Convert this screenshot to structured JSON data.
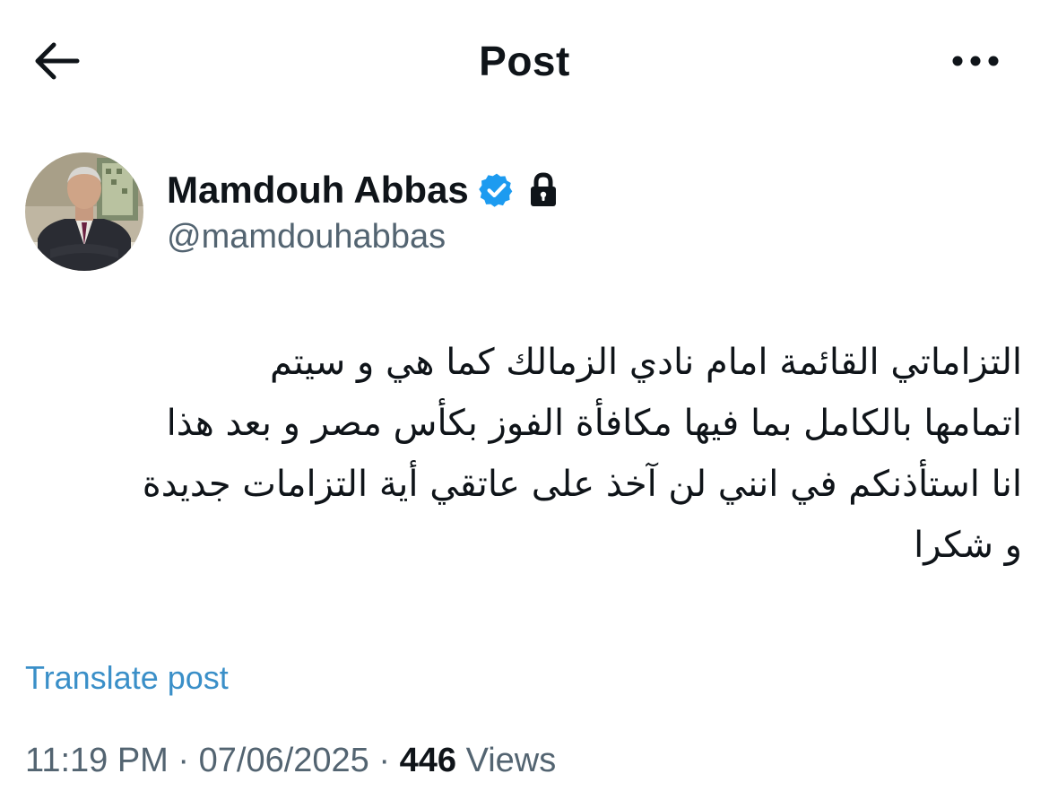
{
  "header": {
    "title": "Post",
    "back_icon": "arrow-left-icon",
    "more_icon": "more-horizontal-icon"
  },
  "author": {
    "display_name": "Mamdouh Abbas",
    "handle": "@mamdouhabbas",
    "verified": true,
    "protected": true,
    "verified_color": "#1d9bf0"
  },
  "post": {
    "lines": [
      "التزاماتي القائمة امام نادي الزمالك كما  هي و سيتم",
      "اتمامها بالكامل بما فيها مكافأة الفوز بكأس مصر و بعد هذا",
      "انا استأذنكم في انني لن آخذ على عاتقي أية التزامات جديدة",
      "و شكرا"
    ],
    "translate_label": "Translate post",
    "time": "11:19 PM",
    "date": "07/06/2025",
    "separator": "·",
    "views_count": "446",
    "views_label": "Views"
  },
  "colors": {
    "text": "#0f1419",
    "secondary": "#536471",
    "link": "#3a8fc8"
  }
}
